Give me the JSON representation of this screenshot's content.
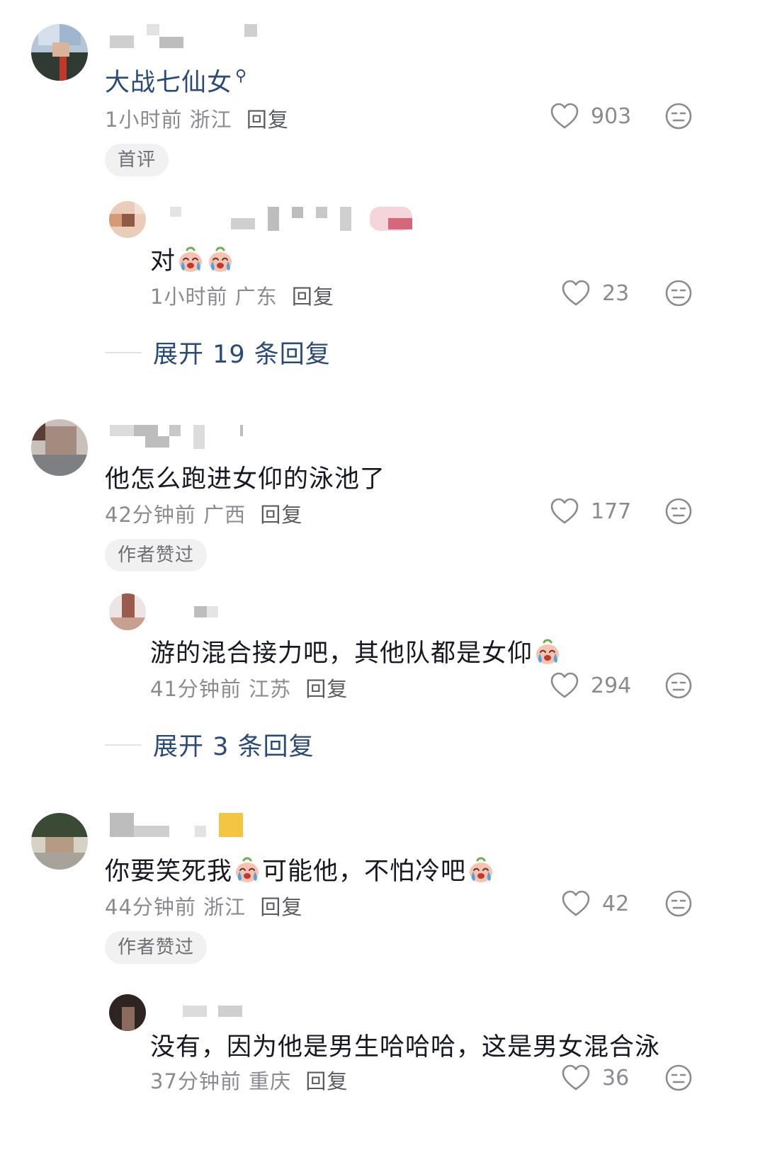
{
  "comments": [
    {
      "text": "大战七仙女",
      "has_search_icon": true,
      "time": "1小时前",
      "location": "浙江",
      "reply_label": "回复",
      "likes": "903",
      "tag": "首评",
      "reply": {
        "text_prefix": "对",
        "time": "1小时前",
        "location": "广东",
        "reply_label": "回复",
        "likes": "23"
      },
      "expand_label": "展开 19 条回复"
    },
    {
      "text": "他怎么跑进女仰的泳池了",
      "time": "42分钟前",
      "location": "广西",
      "reply_label": "回复",
      "likes": "177",
      "tag": "作者赞过",
      "reply": {
        "text": "游的混合接力吧，其他队都是女仰",
        "time": "41分钟前",
        "location": "江苏",
        "reply_label": "回复",
        "likes": "294"
      },
      "expand_label": "展开 3 条回复"
    },
    {
      "text_a": "你要笑死我",
      "text_b": "可能他，不怕冷吧",
      "time": "44分钟前",
      "location": "浙江",
      "reply_label": "回复",
      "likes": "42",
      "tag": "作者赞过",
      "reply": {
        "text": "没有，因为他是男生哈哈哈，这是男女混合泳",
        "time": "37分钟前",
        "location": "重庆",
        "reply_label": "回复",
        "likes": "36"
      }
    }
  ],
  "icons": {
    "like": "heart-outline-icon",
    "dislike": "neutral-face-icon",
    "emoji": "crying-face-emoji"
  },
  "colors": {
    "text": "#161823",
    "meta": "#8a8b91",
    "link": "#2a4a7a",
    "tag_bg": "#f1f1f2"
  }
}
